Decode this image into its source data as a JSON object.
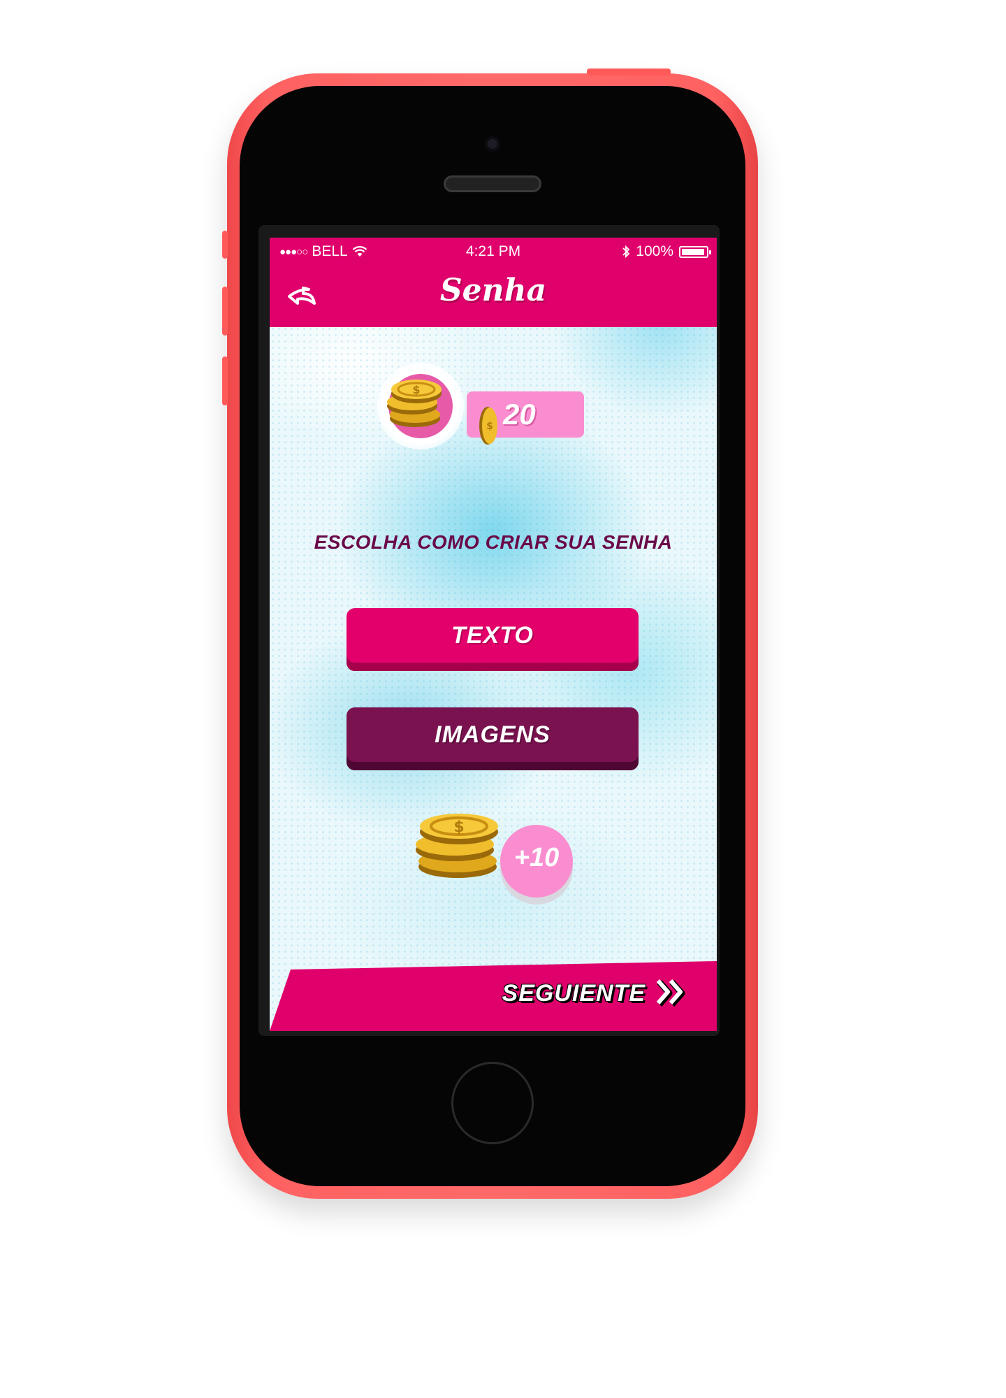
{
  "status_bar": {
    "signal": "●●●○○",
    "carrier": "BELL",
    "time": "4:21 PM",
    "battery": "100%"
  },
  "nav": {
    "title": "Senha",
    "back_icon": "back-arrow-icon"
  },
  "coins": {
    "balance": "20"
  },
  "main": {
    "prompt": "ESCOLHA COMO CRIAR SUA SENHA",
    "option_text": "TEXTO",
    "option_images": "IMAGENS"
  },
  "bonus": {
    "label": "+10"
  },
  "footer": {
    "next_label": "SEGUIENTE",
    "next_icon": "double-chevron-right-icon"
  },
  "colors": {
    "brand_pink": "#e0006c",
    "dark_purple": "#7a1250",
    "light_pink": "#f98dcf",
    "phone_body": "#ff6a68"
  }
}
